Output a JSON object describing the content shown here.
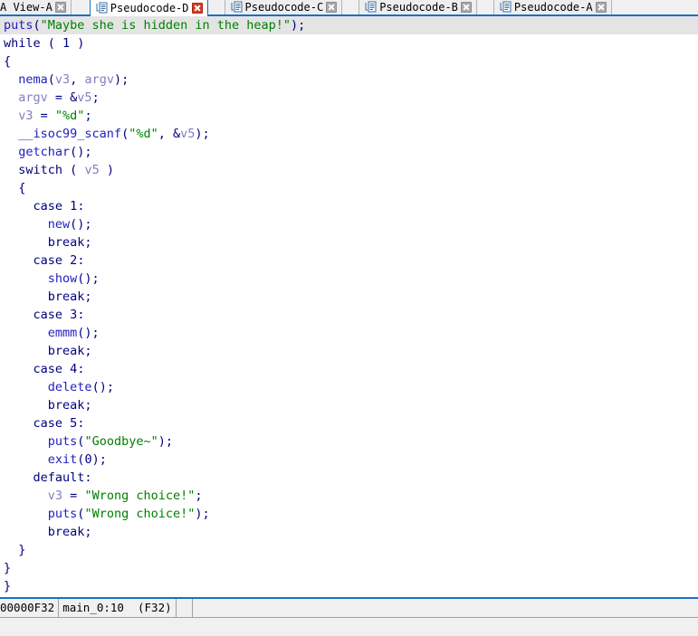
{
  "tabs": [
    {
      "label": "A View-A",
      "icon": "document-icon",
      "active": false,
      "close": "gray",
      "truncated": true
    },
    {
      "label": "Pseudocode-D",
      "icon": "document-icon",
      "active": true,
      "close": "red",
      "truncated": false
    },
    {
      "label": "Pseudocode-C",
      "icon": "document-icon",
      "active": false,
      "close": "gray",
      "truncated": false
    },
    {
      "label": "Pseudocode-B",
      "icon": "document-icon",
      "active": false,
      "close": "gray",
      "truncated": false
    },
    {
      "label": "Pseudocode-A",
      "icon": "document-icon",
      "active": false,
      "close": "gray",
      "truncated": false
    }
  ],
  "code": {
    "lines": [
      {
        "current": true,
        "tokens": [
          {
            "t": "fn",
            "s": "puts"
          },
          {
            "t": "pun",
            "s": "("
          },
          {
            "t": "str",
            "s": "\"Maybe she is hidden in the heap!\""
          },
          {
            "t": "pun",
            "s": ");"
          }
        ]
      },
      {
        "current": false,
        "tokens": [
          {
            "t": "kw",
            "s": "while"
          },
          {
            "t": "pun",
            "s": " ( "
          },
          {
            "t": "num",
            "s": "1"
          },
          {
            "t": "pun",
            "s": " )"
          }
        ]
      },
      {
        "current": false,
        "tokens": [
          {
            "t": "pun",
            "s": "{"
          }
        ]
      },
      {
        "current": false,
        "tokens": [
          {
            "t": "pun",
            "s": "  "
          },
          {
            "t": "fn",
            "s": "nema"
          },
          {
            "t": "pun",
            "s": "("
          },
          {
            "t": "var",
            "s": "v3"
          },
          {
            "t": "pun",
            "s": ", "
          },
          {
            "t": "var",
            "s": "argv"
          },
          {
            "t": "pun",
            "s": ");"
          }
        ]
      },
      {
        "current": false,
        "tokens": [
          {
            "t": "pun",
            "s": "  "
          },
          {
            "t": "var",
            "s": "argv"
          },
          {
            "t": "pun",
            "s": " = &"
          },
          {
            "t": "var",
            "s": "v5"
          },
          {
            "t": "pun",
            "s": ";"
          }
        ]
      },
      {
        "current": false,
        "tokens": [
          {
            "t": "pun",
            "s": "  "
          },
          {
            "t": "var",
            "s": "v3"
          },
          {
            "t": "pun",
            "s": " = "
          },
          {
            "t": "str",
            "s": "\"%d\""
          },
          {
            "t": "pun",
            "s": ";"
          }
        ]
      },
      {
        "current": false,
        "tokens": [
          {
            "t": "pun",
            "s": "  "
          },
          {
            "t": "fn",
            "s": "__isoc99_scanf"
          },
          {
            "t": "pun",
            "s": "("
          },
          {
            "t": "str",
            "s": "\"%d\""
          },
          {
            "t": "pun",
            "s": ", &"
          },
          {
            "t": "var",
            "s": "v5"
          },
          {
            "t": "pun",
            "s": ");"
          }
        ]
      },
      {
        "current": false,
        "tokens": [
          {
            "t": "pun",
            "s": "  "
          },
          {
            "t": "fn",
            "s": "getchar"
          },
          {
            "t": "pun",
            "s": "();"
          }
        ]
      },
      {
        "current": false,
        "tokens": [
          {
            "t": "pun",
            "s": "  "
          },
          {
            "t": "kw",
            "s": "switch"
          },
          {
            "t": "pun",
            "s": " ( "
          },
          {
            "t": "var",
            "s": "v5"
          },
          {
            "t": "pun",
            "s": " )"
          }
        ]
      },
      {
        "current": false,
        "tokens": [
          {
            "t": "pun",
            "s": "  {"
          }
        ]
      },
      {
        "current": false,
        "tokens": [
          {
            "t": "pun",
            "s": "    "
          },
          {
            "t": "kw",
            "s": "case"
          },
          {
            "t": "pun",
            "s": " "
          },
          {
            "t": "num",
            "s": "1"
          },
          {
            "t": "pun",
            "s": ":"
          }
        ]
      },
      {
        "current": false,
        "tokens": [
          {
            "t": "pun",
            "s": "      "
          },
          {
            "t": "fn",
            "s": "new"
          },
          {
            "t": "pun",
            "s": "();"
          }
        ]
      },
      {
        "current": false,
        "tokens": [
          {
            "t": "pun",
            "s": "      "
          },
          {
            "t": "kw",
            "s": "break"
          },
          {
            "t": "pun",
            "s": ";"
          }
        ]
      },
      {
        "current": false,
        "tokens": [
          {
            "t": "pun",
            "s": "    "
          },
          {
            "t": "kw",
            "s": "case"
          },
          {
            "t": "pun",
            "s": " "
          },
          {
            "t": "num",
            "s": "2"
          },
          {
            "t": "pun",
            "s": ":"
          }
        ]
      },
      {
        "current": false,
        "tokens": [
          {
            "t": "pun",
            "s": "      "
          },
          {
            "t": "fn",
            "s": "show"
          },
          {
            "t": "pun",
            "s": "();"
          }
        ]
      },
      {
        "current": false,
        "tokens": [
          {
            "t": "pun",
            "s": "      "
          },
          {
            "t": "kw",
            "s": "break"
          },
          {
            "t": "pun",
            "s": ";"
          }
        ]
      },
      {
        "current": false,
        "tokens": [
          {
            "t": "pun",
            "s": "    "
          },
          {
            "t": "kw",
            "s": "case"
          },
          {
            "t": "pun",
            "s": " "
          },
          {
            "t": "num",
            "s": "3"
          },
          {
            "t": "pun",
            "s": ":"
          }
        ]
      },
      {
        "current": false,
        "tokens": [
          {
            "t": "pun",
            "s": "      "
          },
          {
            "t": "fn",
            "s": "emmm"
          },
          {
            "t": "pun",
            "s": "();"
          }
        ]
      },
      {
        "current": false,
        "tokens": [
          {
            "t": "pun",
            "s": "      "
          },
          {
            "t": "kw",
            "s": "break"
          },
          {
            "t": "pun",
            "s": ";"
          }
        ]
      },
      {
        "current": false,
        "tokens": [
          {
            "t": "pun",
            "s": "    "
          },
          {
            "t": "kw",
            "s": "case"
          },
          {
            "t": "pun",
            "s": " "
          },
          {
            "t": "num",
            "s": "4"
          },
          {
            "t": "pun",
            "s": ":"
          }
        ]
      },
      {
        "current": false,
        "tokens": [
          {
            "t": "pun",
            "s": "      "
          },
          {
            "t": "fn",
            "s": "delete"
          },
          {
            "t": "pun",
            "s": "();"
          }
        ]
      },
      {
        "current": false,
        "tokens": [
          {
            "t": "pun",
            "s": "      "
          },
          {
            "t": "kw",
            "s": "break"
          },
          {
            "t": "pun",
            "s": ";"
          }
        ]
      },
      {
        "current": false,
        "tokens": [
          {
            "t": "pun",
            "s": "    "
          },
          {
            "t": "kw",
            "s": "case"
          },
          {
            "t": "pun",
            "s": " "
          },
          {
            "t": "num",
            "s": "5"
          },
          {
            "t": "pun",
            "s": ":"
          }
        ]
      },
      {
        "current": false,
        "tokens": [
          {
            "t": "pun",
            "s": "      "
          },
          {
            "t": "fn",
            "s": "puts"
          },
          {
            "t": "pun",
            "s": "("
          },
          {
            "t": "str",
            "s": "\"Goodbye~\""
          },
          {
            "t": "pun",
            "s": ");"
          }
        ]
      },
      {
        "current": false,
        "tokens": [
          {
            "t": "pun",
            "s": "      "
          },
          {
            "t": "fn",
            "s": "exit"
          },
          {
            "t": "pun",
            "s": "("
          },
          {
            "t": "num",
            "s": "0"
          },
          {
            "t": "pun",
            "s": ");"
          }
        ]
      },
      {
        "current": false,
        "tokens": [
          {
            "t": "pun",
            "s": "    "
          },
          {
            "t": "kw",
            "s": "default"
          },
          {
            "t": "pun",
            "s": ":"
          }
        ]
      },
      {
        "current": false,
        "tokens": [
          {
            "t": "pun",
            "s": "      "
          },
          {
            "t": "var",
            "s": "v3"
          },
          {
            "t": "pun",
            "s": " = "
          },
          {
            "t": "str",
            "s": "\"Wrong choice!\""
          },
          {
            "t": "pun",
            "s": ";"
          }
        ]
      },
      {
        "current": false,
        "tokens": [
          {
            "t": "pun",
            "s": "      "
          },
          {
            "t": "fn",
            "s": "puts"
          },
          {
            "t": "pun",
            "s": "("
          },
          {
            "t": "str",
            "s": "\"Wrong choice!\""
          },
          {
            "t": "pun",
            "s": ");"
          }
        ]
      },
      {
        "current": false,
        "tokens": [
          {
            "t": "pun",
            "s": "      "
          },
          {
            "t": "kw",
            "s": "break"
          },
          {
            "t": "pun",
            "s": ";"
          }
        ]
      },
      {
        "current": false,
        "tokens": [
          {
            "t": "pun",
            "s": "  }"
          }
        ]
      },
      {
        "current": false,
        "tokens": [
          {
            "t": "pun",
            "s": "}"
          }
        ]
      },
      {
        "current": false,
        "tokens": [
          {
            "t": "pun",
            "s": "}"
          }
        ]
      }
    ]
  },
  "statusbar": {
    "address": "00000F32",
    "location": "main_0:10  (F32)"
  },
  "colors": {
    "accent": "#1a6fc4",
    "keyword": "#00007f",
    "function": "#2020c0",
    "variable": "#8080c0",
    "string": "#008000",
    "current_line": "#e4e4e4",
    "tab_close_active": "#d63a25",
    "tab_close_inactive": "#a8a8a8"
  }
}
